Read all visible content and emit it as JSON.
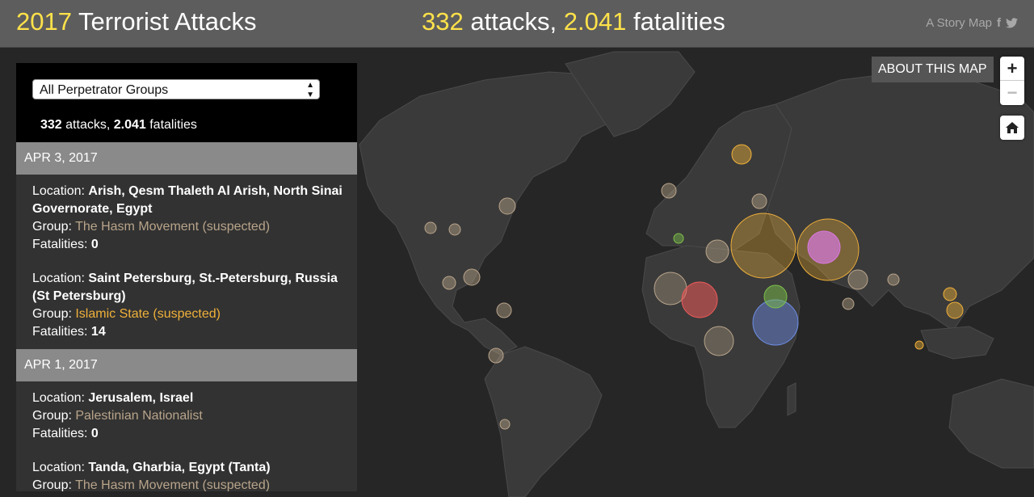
{
  "header": {
    "title_year": "2017",
    "title_rest": " Terrorist Attacks",
    "attacks": "332",
    "attacks_label": " attacks, ",
    "fatalities": "2.041",
    "fatalities_label": " fatalities",
    "storymap": "A Story Map",
    "facebook_glyph": "f",
    "twitter_glyph": "🐦"
  },
  "colors": {
    "header_bg": "#5d5d5d",
    "accent_yellow": "#ffe24a",
    "hasm": "#b8a48a",
    "islamic_state": "#f0b13a"
  },
  "panel": {
    "select_value": "All Perpetrator Groups",
    "summary_attacks": "332",
    "summary_attacks_label": " attacks, ",
    "summary_fatalities": "2.041",
    "summary_fatalities_label": " fatalities",
    "groups": [
      {
        "date": "APR 3, 2017",
        "events": [
          {
            "location_label": "Location: ",
            "location": "Arish, Qesm Thaleth Al Arish, North Sinai Governorate, Egypt",
            "group_label": "Group: ",
            "group": "The Hasm Movement (suspected)",
            "fatalities_label": "Fatalities: ",
            "fatalities": "0"
          },
          {
            "location_label": "Location: ",
            "location": "Saint Petersburg, St.-Petersburg, Russia (St Petersburg)",
            "group_label": "Group: ",
            "group": "Islamic State (suspected)",
            "fatalities_label": "Fatalities: ",
            "fatalities": "14"
          }
        ]
      },
      {
        "date": "APR 1, 2017",
        "events": [
          {
            "location_label": "Location: ",
            "location": "Jerusalem, Israel",
            "group_label": "Group: ",
            "group": "Palestinian Nationalist",
            "fatalities_label": "Fatalities: ",
            "fatalities": "0"
          },
          {
            "location_label": "Location: ",
            "location": "Tanda, Gharbia, Egypt (Tanta)",
            "group_label": "Group: ",
            "group": "The Hasm Movement (suspected)"
          }
        ]
      }
    ]
  },
  "controls": {
    "about": "ABOUT THIS MAP",
    "zoom_in": "+",
    "zoom_out": "−"
  }
}
